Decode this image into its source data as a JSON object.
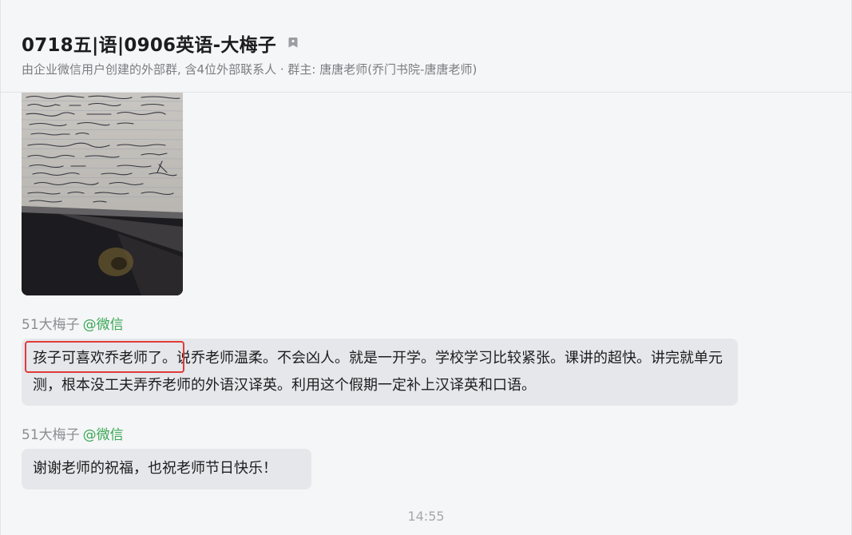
{
  "header": {
    "title": "0718五|语|0906英语-大梅子",
    "subtitle": "由企业微信用户创建的外部群, 含4位外部联系人 · 群主: 唐唐老师(乔门书院-唐唐老师)",
    "tag_icon": "tag-icon"
  },
  "messages": [
    {
      "type": "image",
      "icon": "photo-of-handwritten-notes"
    },
    {
      "type": "text",
      "sender": "51大梅子",
      "sender_source": "@微信",
      "highlighted_text": "孩子可喜欢乔老师了。",
      "text": "说乔老师温柔。不会凶人。就是一开学。学校学习比较紧张。课讲的超快。讲完就单元测，根本没工夫弄乔老师的外语汉译英。利用这个假期一定补上汉译英和口语。"
    },
    {
      "type": "text",
      "sender": "51大梅子",
      "sender_source": "@微信",
      "text": "谢谢老师的祝福，也祝老师节日快乐！"
    }
  ],
  "timestamp": "14:55",
  "colors": {
    "highlight_border": "#e03a3a",
    "source_green": "#3aa755",
    "bubble_bg": "#e5e7ea"
  }
}
